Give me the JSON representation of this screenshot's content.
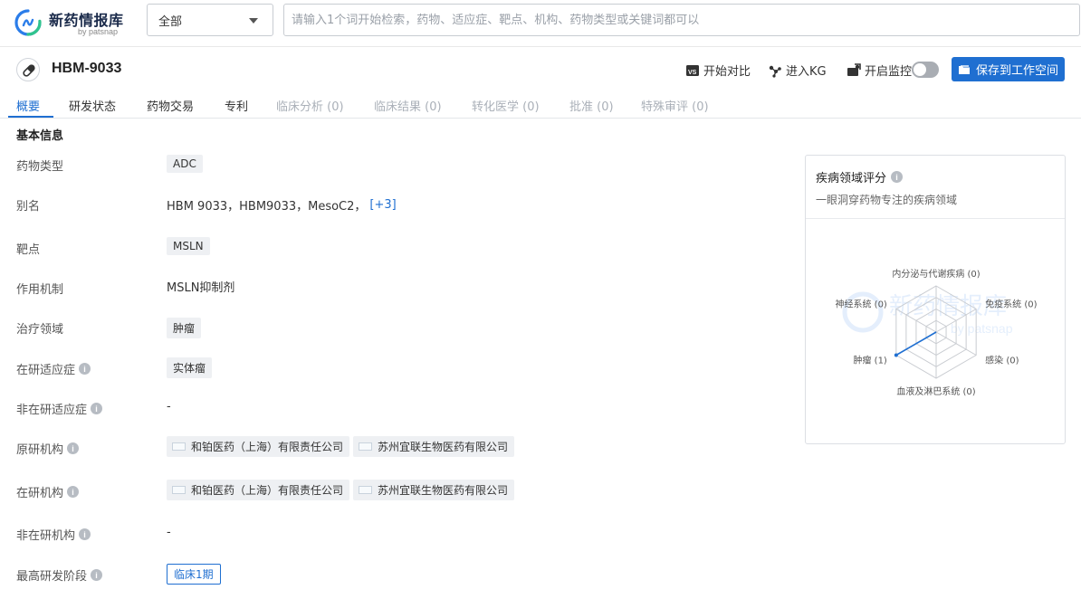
{
  "header": {
    "logo_title": "新药情报库",
    "logo_sub": "by patsnap",
    "scope_value": "全部",
    "search_placeholder": "请输入1个词开始检索，药物、适应症、靶点、机构、药物类型或关键词都可以"
  },
  "drug": {
    "name": "HBM-9033"
  },
  "actions": {
    "compare": "开始对比",
    "kg": "进入KG",
    "monitor": "开启监控",
    "monitor_on": false,
    "save": "保存到工作空间"
  },
  "tabs": [
    {
      "label": "概要",
      "state": "active"
    },
    {
      "label": "研发状态",
      "state": "enabled"
    },
    {
      "label": "药物交易",
      "state": "enabled"
    },
    {
      "label": "专利",
      "state": "enabled"
    },
    {
      "label": "临床分析 (0)",
      "state": "disabled"
    },
    {
      "label": "临床结果 (0)",
      "state": "disabled"
    },
    {
      "label": "转化医学 (0)",
      "state": "disabled"
    },
    {
      "label": "批准 (0)",
      "state": "disabled"
    },
    {
      "label": "特殊审评 (0)",
      "state": "disabled"
    }
  ],
  "basic_info": {
    "title": "基本信息",
    "drug_type": {
      "label": "药物类型",
      "value": "ADC"
    },
    "alias": {
      "label": "别名",
      "value": "HBM 9033，HBM9033，MesoC2，",
      "more": "[+3]"
    },
    "target": {
      "label": "靶点",
      "value": "MSLN"
    },
    "mechanism": {
      "label": "作用机制",
      "value": "MSLN抑制剂"
    },
    "therapy_area": {
      "label": "治疗领域",
      "value": "肿瘤"
    },
    "active_indication": {
      "label": "在研适应症",
      "value": "实体瘤"
    },
    "inactive_indication": {
      "label": "非在研适应症",
      "value": "-"
    },
    "originator": {
      "label": "原研机构",
      "orgs": [
        "和铂医药（上海）有限责任公司",
        "苏州宜联生物医药有限公司"
      ]
    },
    "active_org": {
      "label": "在研机构",
      "orgs": [
        "和铂医药（上海）有限责任公司",
        "苏州宜联生物医药有限公司"
      ]
    },
    "inactive_org": {
      "label": "非在研机构",
      "value": "-"
    },
    "highest_phase": {
      "label": "最高研发阶段",
      "value": "临床1期"
    }
  },
  "disease_panel": {
    "title": "疾病领域评分",
    "subtitle": "一眼洞穿药物专注的疾病领域",
    "watermark_title": "新药情报库",
    "watermark_sub": "by patsnap"
  },
  "chart_data": {
    "type": "radar",
    "axes": [
      "内分泌与代谢疾病",
      "免疫系统",
      "感染",
      "血液及淋巴系统",
      "肿瘤",
      "神经系统"
    ],
    "values": [
      0,
      0,
      0,
      0,
      1,
      0
    ],
    "labels": [
      "内分泌与代谢疾病 (0)",
      "免疫系统 (0)",
      "感染 (0)",
      "血液及淋巴系统 (0)",
      "肿瘤 (1)",
      "神经系统 (0)"
    ],
    "max": 1,
    "levels": 4,
    "series_color": "#1f6fd1"
  },
  "colors": {
    "accent": "#1f6fd1",
    "disabled_text": "#aab0b8"
  }
}
